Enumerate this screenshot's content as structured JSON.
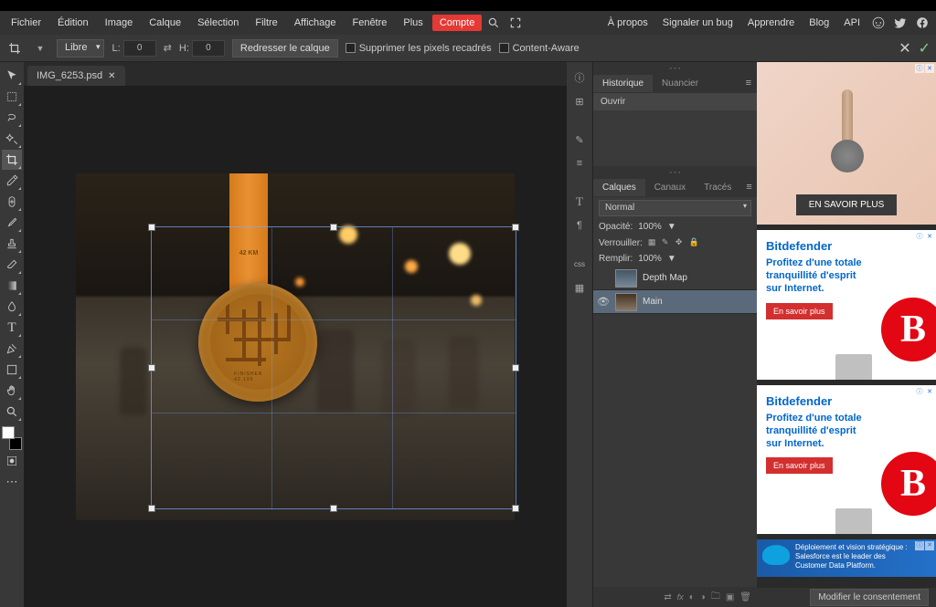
{
  "menubar": {
    "items": [
      "Fichier",
      "Édition",
      "Image",
      "Calque",
      "Sélection",
      "Filtre",
      "Affichage",
      "Fenêtre",
      "Plus"
    ],
    "account": "Compte",
    "right": [
      "À propos",
      "Signaler un bug",
      "Apprendre",
      "Blog",
      "API"
    ]
  },
  "optbar": {
    "ratio": "Libre",
    "w_label": "L:",
    "h_label": "H:",
    "w": "0",
    "h": "0",
    "swap": "⇄",
    "straighten": "Redresser le calque",
    "delete_cropped": "Supprimer les pixels recadrés",
    "content_aware": "Content-Aware"
  },
  "tab": {
    "filename": "IMG_6253.psd"
  },
  "ribbon_text": "42 KM",
  "medal_text": "FINISHER 42.195",
  "side_icons": [
    "ⓘ",
    "⊞",
    "✎",
    "≡",
    "T",
    "¶",
    "css"
  ],
  "panels": {
    "history_tab": "Historique",
    "swatches_tab": "Nuancier",
    "history_item": "Ouvrir",
    "layers_tab": "Calques",
    "channels_tab": "Canaux",
    "paths_tab": "Tracés",
    "blend_mode": "Normal",
    "opacity_label": "Opacité:",
    "opacity_val": "100%",
    "lock_label": "Verrouiller:",
    "fill_label": "Remplir:",
    "fill_val": "100%",
    "layer1": "Depth Map",
    "layer2": "Main"
  },
  "ads": {
    "ad1_btn": "EN SAVOIR PLUS",
    "brand": "Bitdefender",
    "text_l1": "Profitez d'une totale",
    "text_l2": "tranquillité d'esprit",
    "text_l3": "sur Internet.",
    "cta": "En savoir plus",
    "ad3_l1": "Déploiement et vision stratégique :",
    "ad3_l2": "Salesforce est le leader des",
    "ad3_l3": "Customer Data Platform."
  },
  "consent": "Modifier le consentement"
}
